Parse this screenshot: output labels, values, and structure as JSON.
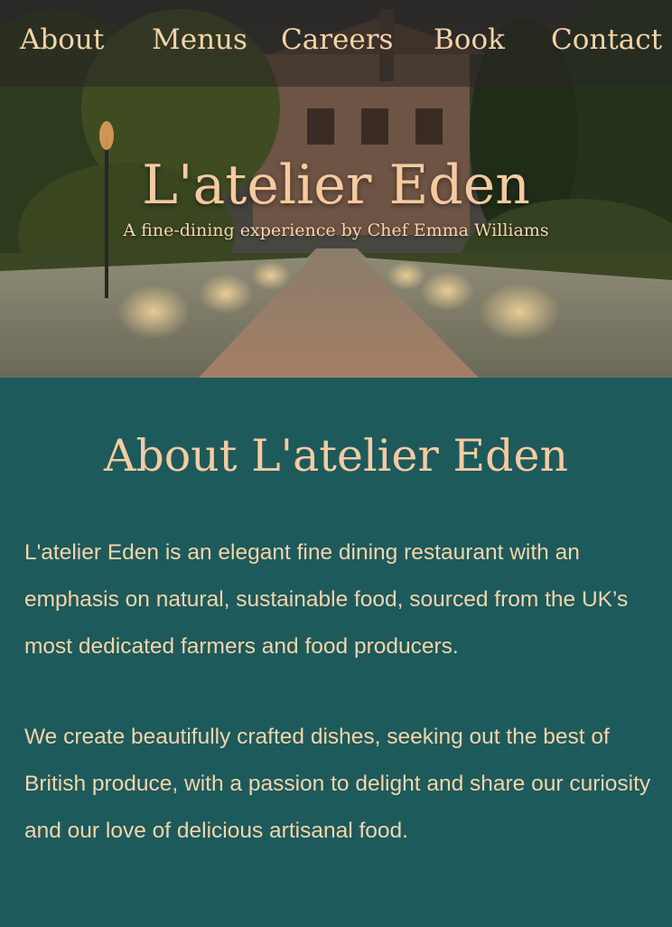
{
  "nav": {
    "items": [
      {
        "label": "About"
      },
      {
        "label": "Menus"
      },
      {
        "label": "Careers"
      },
      {
        "label": "Book"
      },
      {
        "label": "Contact"
      }
    ]
  },
  "hero": {
    "title": "L'atelier Eden",
    "tagline": "A fine-dining experience by Chef Emma Williams"
  },
  "about": {
    "title": "About L'atelier Eden",
    "paragraphs": [
      "L'atelier Eden is an elegant fine dining restaurant with an emphasis on natural, sustainable food, sourced from the UK’s most dedicated farmers and food producers.",
      "We create beautifully crafted dishes, seeking out the best of British produce, with a passion to delight and share our curiosity and our love of delicious artisanal food."
    ]
  },
  "colors": {
    "accent": "#f6cba1",
    "section_bg": "#1d5a5c",
    "nav_overlay": "#282624"
  }
}
